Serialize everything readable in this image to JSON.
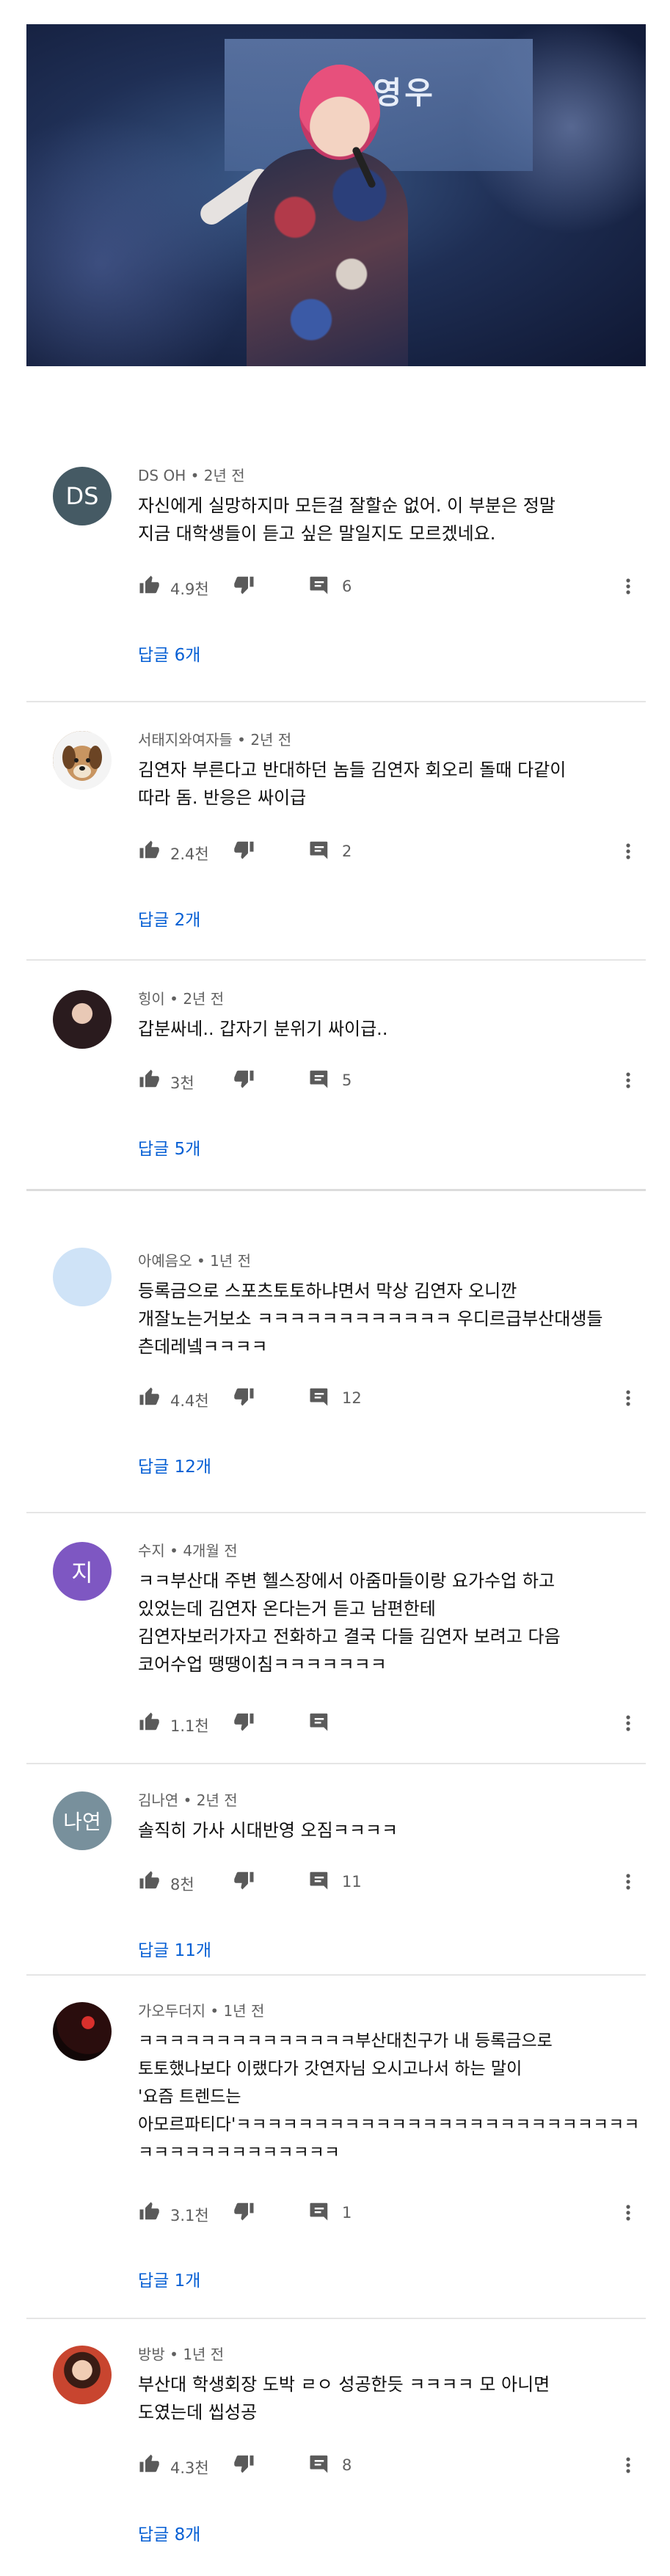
{
  "video": {
    "banner_text": "위영우"
  },
  "comments": [
    {
      "avatar_text": "DS",
      "avatar_color": "#455a64",
      "author": "DS OH",
      "time": "2년 전",
      "text": "자신에게 실망하지마 모든걸 잘할순 없어. 이 부분은 정말\n지금 대학생들이 듣고 싶은 말일지도 모르겠네요.",
      "likes": "4.9천",
      "replies_count": "6",
      "reply_link": "답글 6개"
    },
    {
      "avatar_text": "",
      "avatar_color": "#c9a77c",
      "author": "서태지와여자들",
      "time": "2년 전",
      "text": "김연자 부른다고 반대하던 놈들 김연자 회오리 돌때 다같이\n따라 돔. 반응은 싸이급",
      "likes": "2.4천",
      "replies_count": "2",
      "reply_link": "답글 2개"
    },
    {
      "avatar_text": "",
      "avatar_color": "#2b1e20",
      "author": "힝이",
      "time": "2년 전",
      "text": "갑분싸네.. 갑자기 분위기 싸이급..",
      "likes": "3천",
      "replies_count": "5",
      "reply_link": "답글 5개"
    },
    {
      "avatar_text": "",
      "avatar_color": "#cfe3f7",
      "author": "아예음오",
      "time": "1년 전",
      "text": "등록금으로 스포츠토토하냐면서 막상 김연자 오니깐\n개잘노는거보소 ㅋㅋㅋㅋㅋㅋㅋㅋㅋㅋㅋㅋ 우디르급부산대생들\n츤데레넼ㅋㅋㅋㅋ",
      "likes": "4.4천",
      "replies_count": "12",
      "reply_link": "답글 12개"
    },
    {
      "avatar_text": "지",
      "avatar_color": "#7e57c2",
      "author": "수지",
      "time": "4개월 전",
      "text": "ㅋㅋ부산대 주변 헬스장에서 아줌마들이랑 요가수업 하고\n있었는데 김연자 온다는거 듣고 남편한테\n김연자보러가자고 전화하고 결국 다들 김연자 보려고 다음\n코어수업 땡땡이침ㅋㅋㅋㅋㅋㅋㅋ",
      "likes": "1.1천",
      "replies_count": "",
      "reply_link": ""
    },
    {
      "avatar_text": "나연",
      "avatar_color": "#78909c",
      "author": "김나연",
      "time": "2년 전",
      "text": "솔직히 가사 시대반영 오짐ㅋㅋㅋㅋ",
      "likes": "8천",
      "replies_count": "11",
      "reply_link": "답글 11개"
    },
    {
      "avatar_text": "",
      "avatar_color": "#1a0f0f",
      "author": "가오두더지",
      "time": "1년 전",
      "text": "ㅋㅋㅋㅋㅋㅋㅋㅋㅋㅋㅋㅋㅋㅋ부산대친구가 내 등록금으로\n토토했나보다 이랬다가 갓연자님 오시고나서 하는 말이\n'요즘 트렌드는\n아모르파티다'ㅋㅋㅋㅋㅋㅋㅋㅋㅋㅋㅋㅋㅋㅋㅋㅋㅋㅋㅋㅋㅋㅋㅋㅋㅋㅋ\nㅋㅋㅋㅋㅋㅋㅋㅋㅋㅋㅋㅋㅋ",
      "likes": "3.1천",
      "replies_count": "1",
      "reply_link": "답글 1개"
    },
    {
      "avatar_text": "",
      "avatar_color": "#b86a4e",
      "author": "방방",
      "time": "1년 전",
      "text": "부산대 학생회장 도박 ㄹㅇ 성공한듯 ㅋㅋㅋㅋ 모 아니면\n도였는데 씹성공",
      "likes": "4.3천",
      "replies_count": "8",
      "reply_link": "답글 8개"
    }
  ]
}
